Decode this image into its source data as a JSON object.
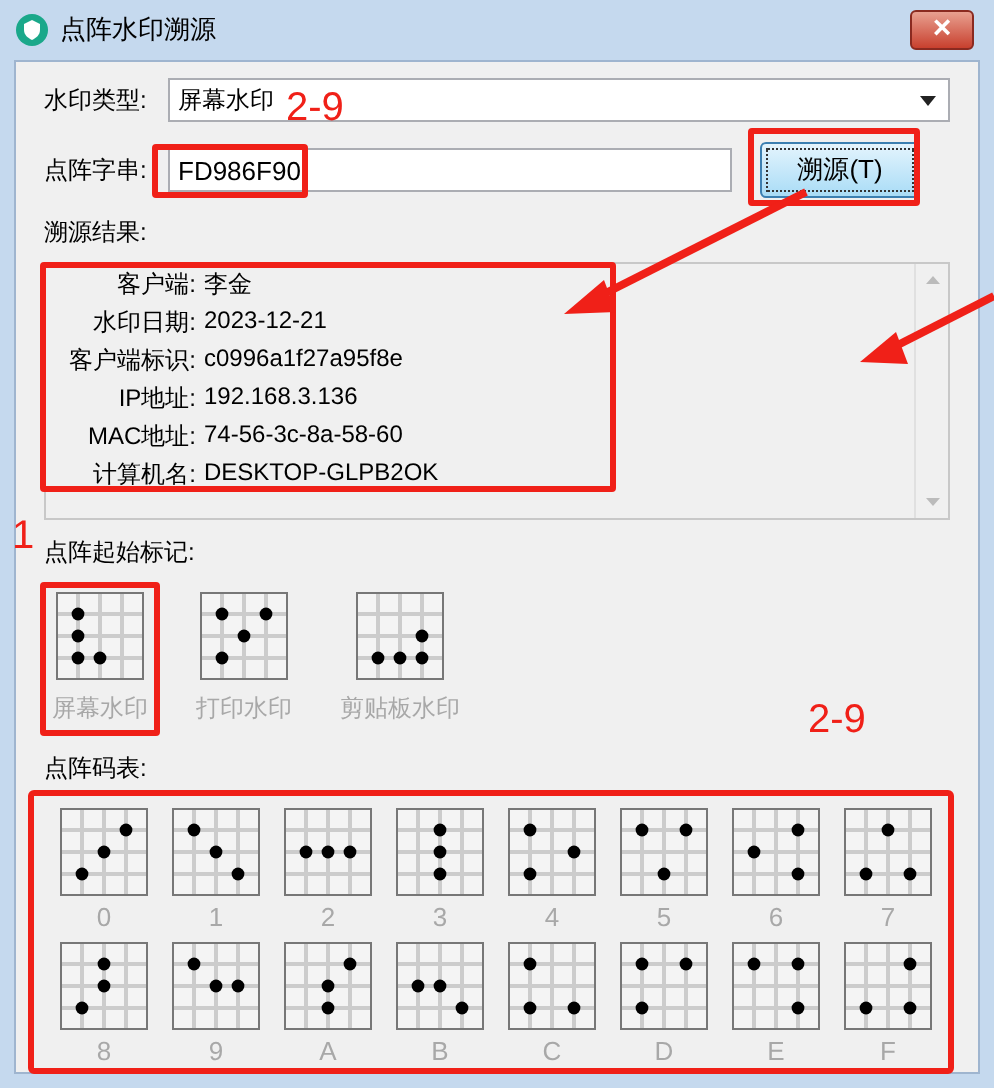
{
  "window": {
    "title": "点阵水印溯源",
    "close": "×"
  },
  "watermark_type": {
    "label": "水印类型:",
    "value": "屏幕水印"
  },
  "dot_string": {
    "label": "点阵字串:",
    "value": "FD986F90"
  },
  "trace_button": {
    "label": "溯源(T)"
  },
  "result": {
    "label": "溯源结果:",
    "rows": [
      {
        "label": "客户端:",
        "value": "李金"
      },
      {
        "label": "水印日期:",
        "value": "2023-12-21"
      },
      {
        "label": "客户端标识:",
        "value": "c0996a1f27a95f8e"
      },
      {
        "label": "IP地址:",
        "value": "192.168.3.136"
      },
      {
        "label": "MAC地址:",
        "value": "74-56-3c-8a-58-60"
      },
      {
        "label": "计算机名:",
        "value": "DESKTOP-GLPB2OK"
      }
    ]
  },
  "start_marks": {
    "label": "点阵起始标记:",
    "items": [
      {
        "label": "屏幕水印",
        "highlighted": true
      },
      {
        "label": "打印水印",
        "highlighted": false
      },
      {
        "label": "剪贴板水印",
        "highlighted": false
      }
    ]
  },
  "code_table": {
    "label": "点阵码表:",
    "items": [
      "0",
      "1",
      "2",
      "3",
      "4",
      "5",
      "6",
      "7",
      "8",
      "9",
      "A",
      "B",
      "C",
      "D",
      "E",
      "F"
    ]
  },
  "annotations": [
    "2-9",
    "1",
    "2-9"
  ]
}
